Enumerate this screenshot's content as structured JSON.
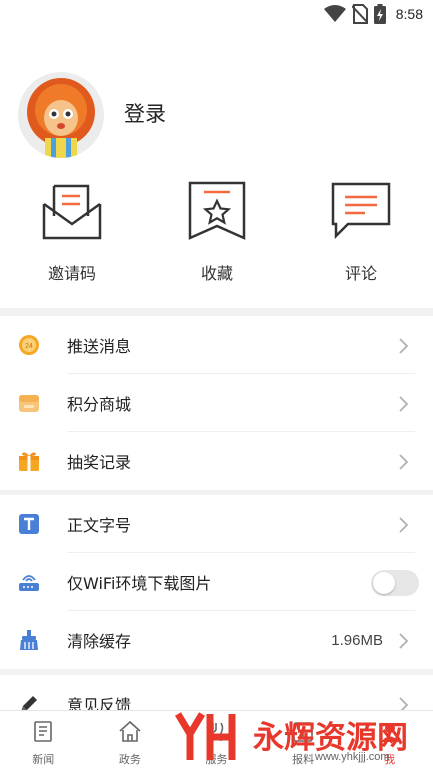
{
  "status_bar": {
    "time": "8:58"
  },
  "profile": {
    "login_label": "登录",
    "quick_actions": [
      {
        "label": "邀请码",
        "icon": "envelope-icon"
      },
      {
        "label": "收藏",
        "icon": "bookmark-star-icon"
      },
      {
        "label": "评论",
        "icon": "comment-icon"
      }
    ]
  },
  "menu": {
    "group1": [
      {
        "label": "推送消息",
        "icon": "push-24-icon"
      },
      {
        "label": "积分商城",
        "icon": "mall-icon"
      },
      {
        "label": "抽奖记录",
        "icon": "gift-icon"
      }
    ],
    "group2": [
      {
        "label": "正文字号",
        "icon": "text-size-icon"
      },
      {
        "label": "仅WiFi环境下载图片",
        "icon": "router-icon",
        "toggle": false
      },
      {
        "label": "清除缓存",
        "icon": "broom-icon",
        "value": "1.96MB"
      }
    ],
    "group3": [
      {
        "label": "意见反馈",
        "icon": "pencil-icon"
      }
    ]
  },
  "tabbar": {
    "tabs": [
      {
        "label": "新闻",
        "icon": "news-icon"
      },
      {
        "label": "政务",
        "icon": "government-icon"
      },
      {
        "label": "服务",
        "icon": "service-icon"
      },
      {
        "label": "报料",
        "icon": "report-icon"
      },
      {
        "label": "我",
        "icon": "me-icon"
      }
    ]
  },
  "watermark": {
    "text": "永辉资源网",
    "url": "www.yhkjjj.com"
  },
  "colors": {
    "accent_orange": "#f26a3d",
    "tab_active": "#e8382c",
    "icon_blue": "#4a7fd6"
  }
}
